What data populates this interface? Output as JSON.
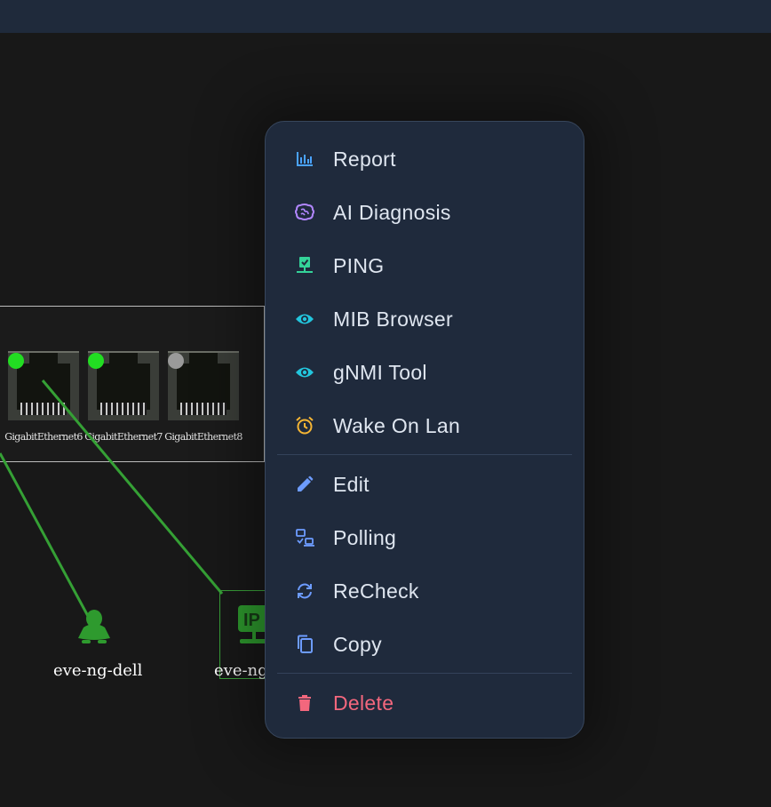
{
  "canvas": {
    "ports": [
      {
        "label": "GigabitEthernet6",
        "status_color": "#22dd22"
      },
      {
        "label": "GigabitEthernet7",
        "status_color": "#22dd22"
      },
      {
        "label": "GigabitEthernet8",
        "status_color": "#9a9a9a"
      }
    ],
    "nodes": [
      {
        "label": "eve-ng-dell",
        "icon": "linux-penguin-icon",
        "color": "#2e9a2e"
      },
      {
        "label": "eve-ng-",
        "icon": "ip-host-icon",
        "color": "#2e9a2e"
      }
    ],
    "link_color": "#35a035"
  },
  "context_menu": {
    "group1": [
      {
        "label": "Report",
        "icon": "chart-bar-icon",
        "color": "#4aa3ff"
      },
      {
        "label": "AI Diagnosis",
        "icon": "brain-icon",
        "color": "#b186ff"
      },
      {
        "label": "PING",
        "icon": "network-check-icon",
        "color": "#34d399"
      },
      {
        "label": "MIB Browser",
        "icon": "eye-icon",
        "color": "#22c5dd"
      },
      {
        "label": "gNMI Tool",
        "icon": "eye-icon",
        "color": "#22c5dd"
      },
      {
        "label": "Wake On Lan",
        "icon": "alarm-clock-icon",
        "color": "#f5b534"
      }
    ],
    "group2": [
      {
        "label": "Edit",
        "icon": "pencil-icon",
        "color": "#6d9cff"
      },
      {
        "label": "Polling",
        "icon": "polling-icon",
        "color": "#6d9cff"
      },
      {
        "label": "ReCheck",
        "icon": "refresh-icon",
        "color": "#6d9cff"
      },
      {
        "label": "Copy",
        "icon": "copy-icon",
        "color": "#6d9cff"
      }
    ],
    "group3": [
      {
        "label": "Delete",
        "icon": "trash-icon",
        "color": "#f3677d"
      }
    ]
  }
}
